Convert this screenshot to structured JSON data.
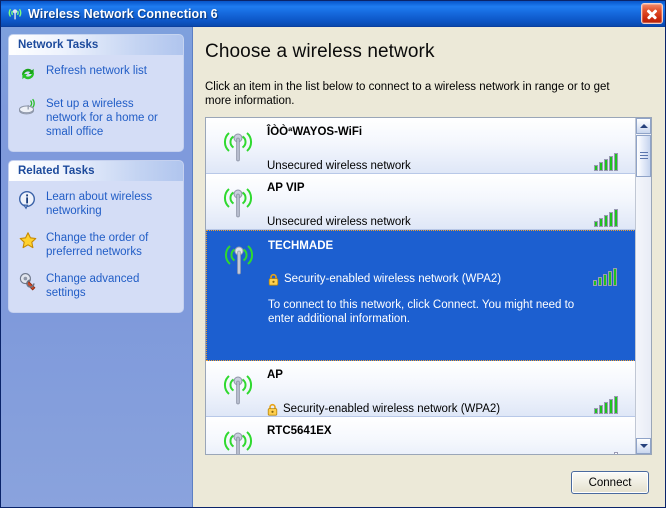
{
  "window": {
    "title": "Wireless Network Connection 6",
    "title_icon": "wireless-signal-icon",
    "close_label": "",
    "accent_titlebar": "#1568dc",
    "sidebar_bg": "#7f9adc",
    "selection_bg": "#1c5fd0"
  },
  "sidebar": {
    "panels": [
      {
        "header": "Network Tasks",
        "items": [
          {
            "label": "Refresh network list",
            "icon": "refresh-icon"
          },
          {
            "label": "Set up a wireless network for a home or small office",
            "icon": "wireless-setup-icon"
          }
        ]
      },
      {
        "header": "Related Tasks",
        "items": [
          {
            "label": "Learn about wireless networking",
            "icon": "info-icon"
          },
          {
            "label": "Change the order of preferred networks",
            "icon": "star-icon"
          },
          {
            "label": "Change advanced settings",
            "icon": "wrench-icon"
          }
        ]
      }
    ]
  },
  "main": {
    "heading": "Choose a wireless network",
    "instructions": "Click an item in the list below to connect to a wireless network in range or to get more information.",
    "networks": [
      {
        "ssid": "ÎÒÒªWAYOS-WiFi",
        "security": "Unsecured wireless network",
        "secured": false,
        "signal_bars": 5,
        "selected": false,
        "hint": ""
      },
      {
        "ssid": "AP VIP",
        "security": "Unsecured wireless network",
        "secured": false,
        "signal_bars": 5,
        "selected": false,
        "hint": ""
      },
      {
        "ssid": "TECHMADE",
        "security": "Security-enabled wireless network (WPA2)",
        "secured": true,
        "signal_bars": 5,
        "selected": true,
        "hint": "To connect to this network, click Connect. You might need to enter additional information."
      },
      {
        "ssid": "AP",
        "security": "Security-enabled wireless network (WPA2)",
        "secured": true,
        "signal_bars": 5,
        "selected": false,
        "hint": ""
      },
      {
        "ssid": "RTC5641EX",
        "security": "",
        "secured": false,
        "signal_bars": 2,
        "selected": false,
        "hint": ""
      }
    ]
  },
  "footer": {
    "connect_label": "Connect"
  }
}
